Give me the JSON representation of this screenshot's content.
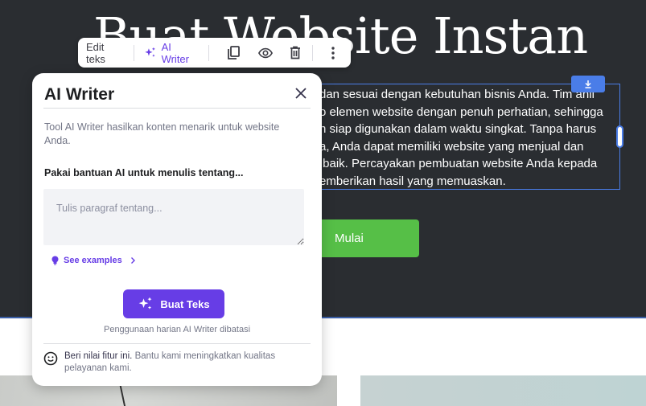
{
  "hero": {
    "title": "Buat Website Instan",
    "body_lines": [
      "dan sesuai dengan kebutuhan bisnis Anda. Tim ahli",
      "o elemen website dengan penuh perhatian, sehingga",
      "n siap digunakan dalam waktu singkat. Tanpa harus",
      "a, Anda dapat memiliki website yang menjual dan",
      " baik. Percayakan pembuatan website Anda kepada",
      "emberikan hasil yang memuaskan."
    ],
    "cta_label": "Mulai",
    "drag_icon": "download-arrow-icon"
  },
  "toolbar": {
    "edit_label": "Edit teks",
    "ai_label": "AI Writer",
    "icons": [
      "duplicate-icon",
      "eye-icon",
      "trash-icon",
      "more-vertical-icon"
    ]
  },
  "panel": {
    "title": "AI Writer",
    "description": "Tool AI Writer hasilkan konten menarik untuk website Anda.",
    "prompt_label": "Pakai bantuan AI untuk menulis tentang...",
    "textarea_placeholder": "Tulis paragraf tentang...",
    "textarea_value": "",
    "see_examples": "See examples",
    "generate_label": "Buat Teks",
    "usage_note": "Penggunaan harian AI Writer dibatasi",
    "feedback_strong": "Beri nilai fitur ini.",
    "feedback_rest": " Bantu kami meningkatkan kualitas pelayanan kami."
  },
  "colors": {
    "accent": "#673de6",
    "cta_green": "#56bf47",
    "selection_blue": "#4a7de8",
    "hero_bg": "#2a2d31"
  }
}
